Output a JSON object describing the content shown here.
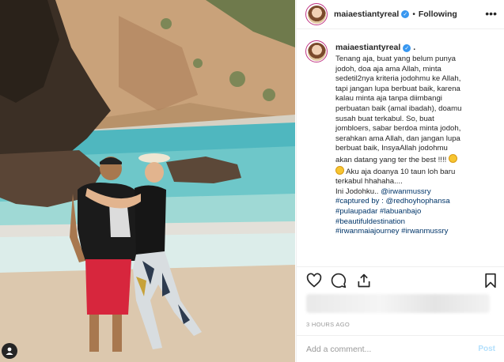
{
  "post": {
    "username": "maiaestiantyreal",
    "follow_status": "Following",
    "caption_lines": [
      "Tenang aja, buat yang belum punya",
      "jodoh, doa aja ama Allah, minta",
      "sedetil2nya kriteria jodohmu ke Allah,",
      "tapi jangan lupa berbuat baik, karena",
      "kalau minta aja tanpa diimbangi",
      "perbuatan baik (amal ibadah), doamu",
      "susah buat terkabul. So, buat",
      "jombloers, sabar berdoa minta jodoh,",
      "serahkan ama Allah, dan jangan lupa",
      "berbuat baik, InsyaAllah jodohmu",
      "akan datang yang ter the best !!!!"
    ],
    "caption_line_12": "Aku aja doanya 10 taun loh baru",
    "caption_line_13": "terkabul hhahaha....",
    "caption_line_14_prefix": "Ini Jodohku.. ",
    "mention_1": "@irwanmussry",
    "captured_prefix": "#captured by : ",
    "mention_2": "@redhoyhophansa",
    "hashtags": [
      "#pulaupadar #labuanbajo",
      "#beautifuldestination",
      "#irwanmaiajourney #irwanmussry"
    ],
    "timestamp": "3 HOURS AGO",
    "comment_placeholder": "Add a comment...",
    "post_label": "Post",
    "separator": "•"
  },
  "icons": {
    "verified": "verified-badge-icon",
    "more": "more-options-icon",
    "like": "heart-icon",
    "comment": "comment-bubble-icon",
    "share": "share-icon",
    "save": "bookmark-icon",
    "tag": "user-tag-icon"
  },
  "colors": {
    "link": "#003569",
    "verified": "#3897f0",
    "post_disabled": "#b2dffc",
    "muted": "#999999"
  }
}
